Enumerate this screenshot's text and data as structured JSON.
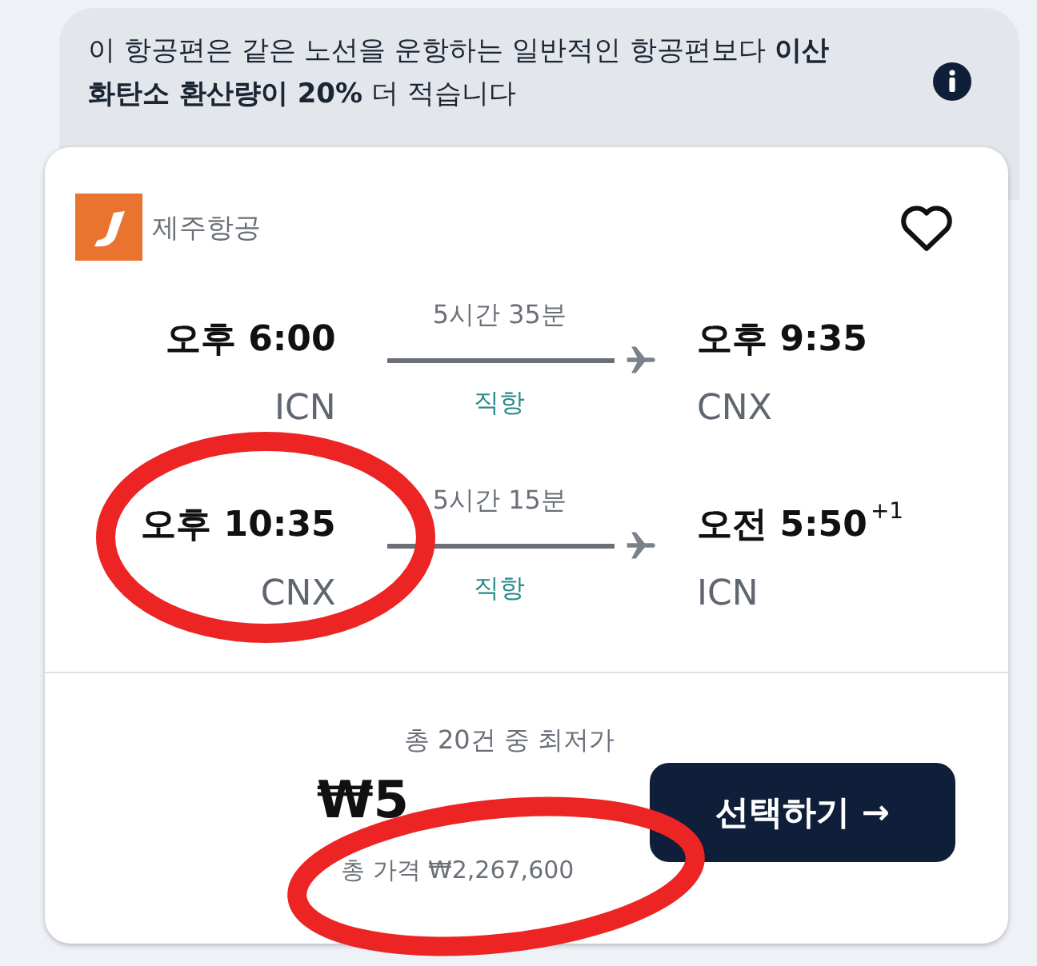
{
  "notice": {
    "text": "이 항공편은 같은 노선을 운항하는 일반적인 항공편보다 **이산화탄소 환산량이 20%** 더 적습니다"
  },
  "airline": {
    "name": "제주항공",
    "favorite": false
  },
  "legs": [
    {
      "depart_time": "오후 6:00",
      "depart_airport": "ICN",
      "duration": "5시간 35분",
      "stops": "직항",
      "arrive_time": "오후 9:35",
      "arrive_airport": "CNX"
    },
    {
      "depart_time": "오후 10:35",
      "depart_airport": "CNX",
      "duration": "5시간 15분",
      "stops": "직항",
      "arrive_time": "오전 5:50",
      "day_offset": "+1",
      "arrive_airport": "ICN"
    }
  ],
  "price": {
    "caption": "총 20건 중 최저가",
    "amount": "₩5",
    "total": "총 가격 ₩2,267,600"
  },
  "select_button": {
    "label": "선택하기 →"
  },
  "annotations": [
    {
      "kind": "marker-circle"
    },
    {
      "kind": "marker-circle"
    }
  ]
}
